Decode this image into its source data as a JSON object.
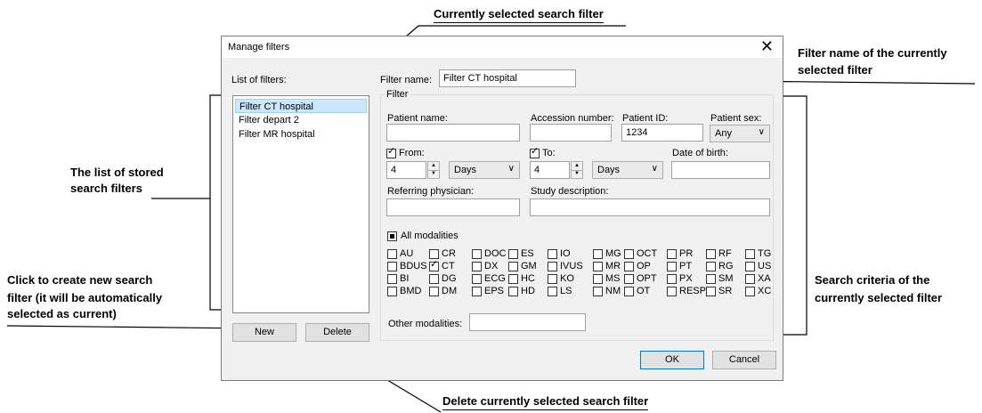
{
  "annotations": {
    "current_filter": "Currently selected search filter",
    "filter_name_1": "Filter name of the currently",
    "filter_name_2": "selected filter",
    "list_1": "The list of stored",
    "list_2": "search filters",
    "new_1": "Click to create new search",
    "new_2": "filter (it will be automatically",
    "new_3": "selected as current)",
    "criteria_1": "Search criteria of the",
    "criteria_2": "currently selected filter",
    "delete": "Delete currently selected search filter"
  },
  "dialog": {
    "title": "Manage filters",
    "close_glyph": "✕",
    "list_label": "List of filters:",
    "filters": [
      "Filter CT hospital",
      "Filter depart 2",
      "Filter MR hospital"
    ],
    "filter_name_label": "Filter name:",
    "filter_name_value": "Filter CT hospital",
    "group_label": "Filter",
    "patient_name_label": "Patient name:",
    "patient_name_value": "",
    "accession_label": "Accession number:",
    "accession_value": "",
    "patient_id_label": "Patient ID:",
    "patient_id_value": "1234",
    "patient_sex_label": "Patient sex:",
    "patient_sex_value": "Any",
    "from_label": "From:",
    "from_checked": true,
    "from_value": "4",
    "from_unit": "Days",
    "to_label": "To:",
    "to_checked": true,
    "to_value": "4",
    "to_unit": "Days",
    "dob_label": "Date of birth:",
    "dob_value": "",
    "referring_label": "Referring physician:",
    "referring_value": "",
    "study_label": "Study description:",
    "study_value": "",
    "all_modalities_label": "All modalities",
    "modalities": [
      [
        "AU",
        "CR",
        "DOC",
        "ES",
        "IO",
        "MG",
        "OCT",
        "PR",
        "RF",
        "TG"
      ],
      [
        "BDUS",
        "CT",
        "DX",
        "GM",
        "IVUS",
        "MR",
        "OP",
        "PT",
        "RG",
        "US"
      ],
      [
        "BI",
        "DG",
        "ECG",
        "HC",
        "KO",
        "MS",
        "OPT",
        "PX",
        "SM",
        "XA"
      ],
      [
        "BMD",
        "DM",
        "EPS",
        "HD",
        "LS",
        "NM",
        "OT",
        "RESP",
        "SR",
        "XC"
      ]
    ],
    "checked_modalities": [
      "CT"
    ],
    "other_modalities_label": "Other modalities:",
    "other_modalities_value": "",
    "new_button": "New",
    "delete_button": "Delete",
    "ok_button": "OK",
    "cancel_button": "Cancel"
  }
}
